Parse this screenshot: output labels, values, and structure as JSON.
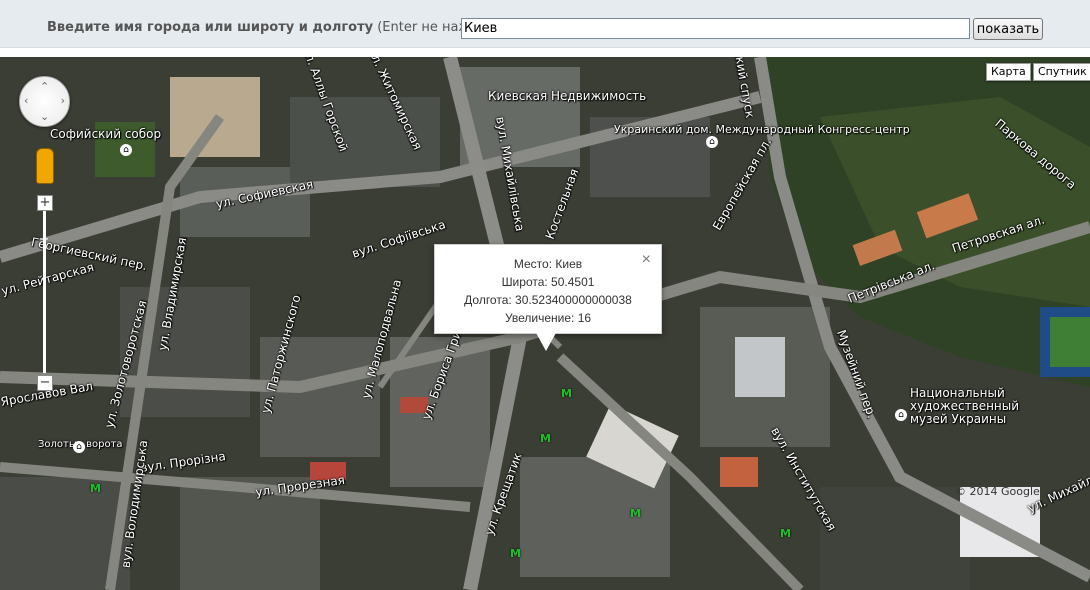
{
  "search": {
    "prompt_bold": "Введите имя города или широту и долготу",
    "prompt_hint": "(Enter не нажимайте):",
    "value": "Киев",
    "button_label": "показать"
  },
  "map_type": {
    "map_label": "Карта",
    "satellite_label": "Спутник"
  },
  "controls": {
    "zoom_in": "+",
    "zoom_out": "−"
  },
  "info_window": {
    "place": "Место: Киев",
    "latitude": "Широта: 50.4501",
    "longitude": "Долгота: 30.523400000000038",
    "zoom": "Увеличение: 16",
    "close": "×"
  },
  "labels": {
    "sofia_sobor": "Софийский собор",
    "kiev_realty": "Киевская Недвижимость",
    "ukr_house": "Украинский дом. Международный Конгресс-центр",
    "alley_gardens": "Паркова дорога",
    "petrovskaya": "Петровская ал.",
    "petrivska": "Петрівська ал.",
    "museum": "Национальный художественный музей Украины",
    "sofievskaya": "ул. Софиевская",
    "sofiivska": "вул. Софіївська",
    "georgievsky": "Георгиевский пер.",
    "reitarskaya": "ул. Рейтарская",
    "vladimirskaya": "ул. Владимирская",
    "zoloto": "ул. Золотоворотская",
    "patorzhinskogo": "ул. Паторжинского",
    "malopodvalnaya": "ул. Малоподвальна",
    "grinchenko": "ул. Бориса Гринченко",
    "kreshatik": "ул. Крещатик",
    "prorizna": "вул. Прорізна",
    "proreznaya": "ул. Прорезная",
    "institutskaya": "вул. Институтская",
    "volodymyrska": "вул. Володимирська",
    "yaroslavov": "Ярославов Вал",
    "zolotye": "Золотые ворота",
    "mikhailovskaya": "вул. Михайлівська",
    "kostelnaya": "Костельная",
    "evropeiskaya": "Европейская пл.",
    "muzeiny": "Музейний пер.",
    "alley_muzeinaya": "ул. Михайл",
    "zhitomirskaya": "ул. Житомирская",
    "alla": "ул. Аллы Горской",
    "desc": "ский спуск",
    "copyright": "© 2014 Google"
  }
}
